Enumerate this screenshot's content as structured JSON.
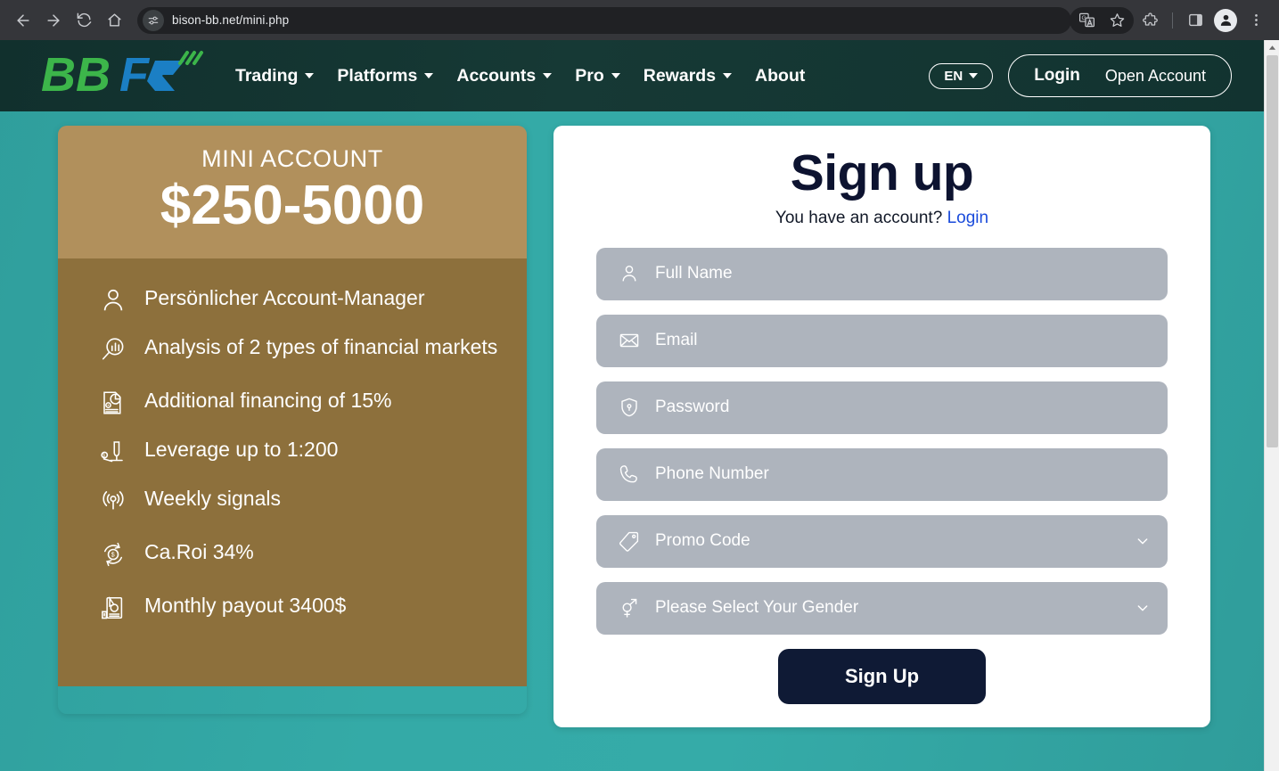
{
  "browser": {
    "url": "bison-bb.net/mini.php",
    "back_icon": "back-arrow-icon",
    "forward_icon": "forward-arrow-icon",
    "reload_icon": "reload-icon",
    "home_icon": "home-icon",
    "site_info_icon": "site-settings-icon",
    "translate_icon": "translate-icon",
    "bookmark_icon": "star-icon",
    "extensions_icon": "extensions-puzzle-icon",
    "side_panel_icon": "side-panel-icon",
    "profile_icon": "profile-avatar-icon",
    "menu_icon": "three-dot-menu-icon"
  },
  "header": {
    "logo_text_1": "BB",
    "logo_text_2": "FX",
    "nav": [
      {
        "label": "Trading",
        "has_dropdown": true
      },
      {
        "label": "Platforms",
        "has_dropdown": true
      },
      {
        "label": "Accounts",
        "has_dropdown": true
      },
      {
        "label": "Pro",
        "has_dropdown": true
      },
      {
        "label": "Rewards",
        "has_dropdown": true
      },
      {
        "label": "About",
        "has_dropdown": false
      }
    ],
    "language": "EN",
    "login_label": "Login",
    "open_account_label": "Open Account"
  },
  "plan_card": {
    "title": "MINI ACCOUNT",
    "price": "$250-5000",
    "features": [
      {
        "icon": "person-icon",
        "text": "Persönlicher Account-Manager"
      },
      {
        "icon": "chart-magnifier-icon",
        "text": "Analysis of 2 types of financial markets"
      },
      {
        "icon": "document-chart-icon",
        "text": "Additional financing of 15%"
      },
      {
        "icon": "leverage-icon",
        "text": "Leverage up to 1:200"
      },
      {
        "icon": "signal-broadcast-icon",
        "text": "Weekly signals"
      },
      {
        "icon": "roi-refresh-icon",
        "text": "Ca.Roi 34%"
      },
      {
        "icon": "cash-payout-icon",
        "text": "Monthly payout 3400$"
      }
    ]
  },
  "signup": {
    "title": "Sign up",
    "subtitle_text": "You have an account?",
    "subtitle_link": "Login",
    "fields": [
      {
        "name": "full-name",
        "icon": "person-icon",
        "placeholder": "Full Name",
        "value": "",
        "type": "text"
      },
      {
        "name": "email",
        "icon": "envelope-icon",
        "placeholder": "Email",
        "value": "",
        "type": "email"
      },
      {
        "name": "password",
        "icon": "shield-lock-icon",
        "placeholder": "Password",
        "value": "",
        "type": "password"
      },
      {
        "name": "phone-number",
        "icon": "phone-icon",
        "placeholder": "Phone Number",
        "value": "",
        "type": "tel"
      },
      {
        "name": "promo-code",
        "icon": "tag-icon",
        "placeholder": "Promo Code",
        "value": "",
        "type": "select"
      },
      {
        "name": "gender",
        "icon": "gender-icon",
        "placeholder": "Please Select Your Gender",
        "value": "",
        "type": "select"
      }
    ],
    "submit_label": "Sign Up"
  },
  "colors": {
    "page_background": "#34aaa7",
    "header_background": "#143532",
    "plan_head": "#b1905c",
    "plan_body": "#8d703c",
    "field_background": "#aeb4bd",
    "submit_background": "#0f1a35",
    "link": "#1a4bdb",
    "logo_green": "#3cb54a",
    "logo_blue": "#1b7fc4"
  }
}
